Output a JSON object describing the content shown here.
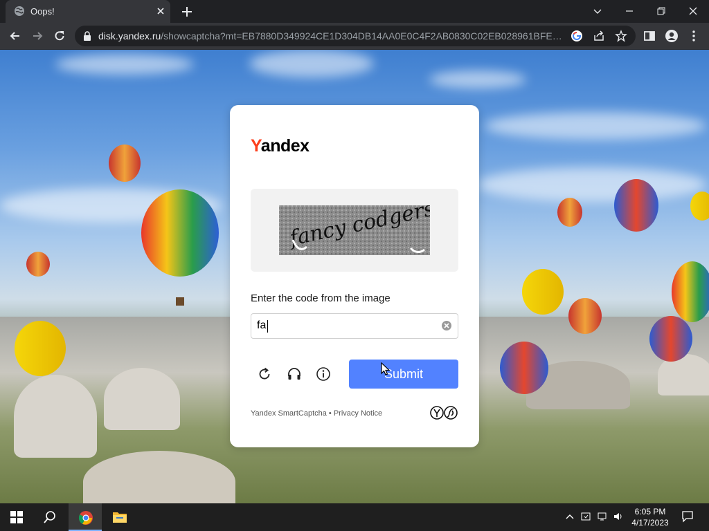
{
  "browser": {
    "tab_title": "Oops!",
    "url_host": "disk.yandex.ru",
    "url_path": "/showcaptcha?mt=EB7880D349924CE1D304DB14AA0E0C4F2AB0830C02EB028961BFEE20C8..."
  },
  "captcha": {
    "brand": {
      "first_letter": "Y",
      "rest": "andex"
    },
    "image_text": "fancy codgers",
    "instruction": "Enter the code from the image",
    "input_value": "fa",
    "submit_label": "Submit",
    "footer": {
      "smartcaptcha": "Yandex SmartCaptcha",
      "separator": " • ",
      "privacy": "Privacy Notice"
    },
    "icons": [
      "refresh-icon",
      "audio-icon",
      "info-icon"
    ]
  },
  "taskbar": {
    "time": "6:05 PM",
    "date": "4/17/2023"
  },
  "colors": {
    "yandex_red": "#fc3f1d",
    "submit_blue": "#5282ff"
  }
}
